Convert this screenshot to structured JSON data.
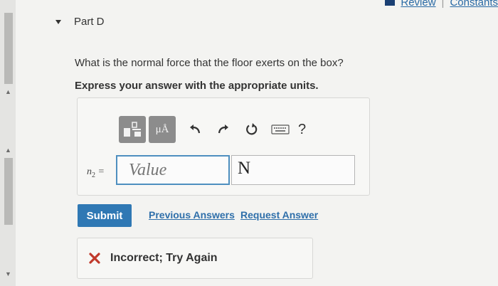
{
  "header": {
    "review_link": "Review",
    "separator": "|",
    "constants_link": "Constants"
  },
  "part": {
    "label": "Part D"
  },
  "question": {
    "text": "What is the normal force that the floor exerts on the box?",
    "instruction": "Express your answer with the appropriate units."
  },
  "toolbar": {
    "units_label": "μÅ",
    "help_label": "?",
    "icons": [
      "templates-icon",
      "units-icon",
      "undo-icon",
      "redo-icon",
      "reset-icon",
      "keyboard-icon",
      "help-icon"
    ]
  },
  "answer": {
    "variable": "n",
    "variable_subscript": "2",
    "equals": "=",
    "value_placeholder": "Value",
    "unit_value": "N"
  },
  "actions": {
    "submit": "Submit",
    "previous_answers": "Previous Answers",
    "request_answer": "Request Answer"
  },
  "feedback": {
    "text": "Incorrect; Try Again",
    "status_color": "#c0392b"
  },
  "colors": {
    "accent": "#2f78b4",
    "link": "#2f6faa",
    "input_focus": "#4e8fbf"
  }
}
